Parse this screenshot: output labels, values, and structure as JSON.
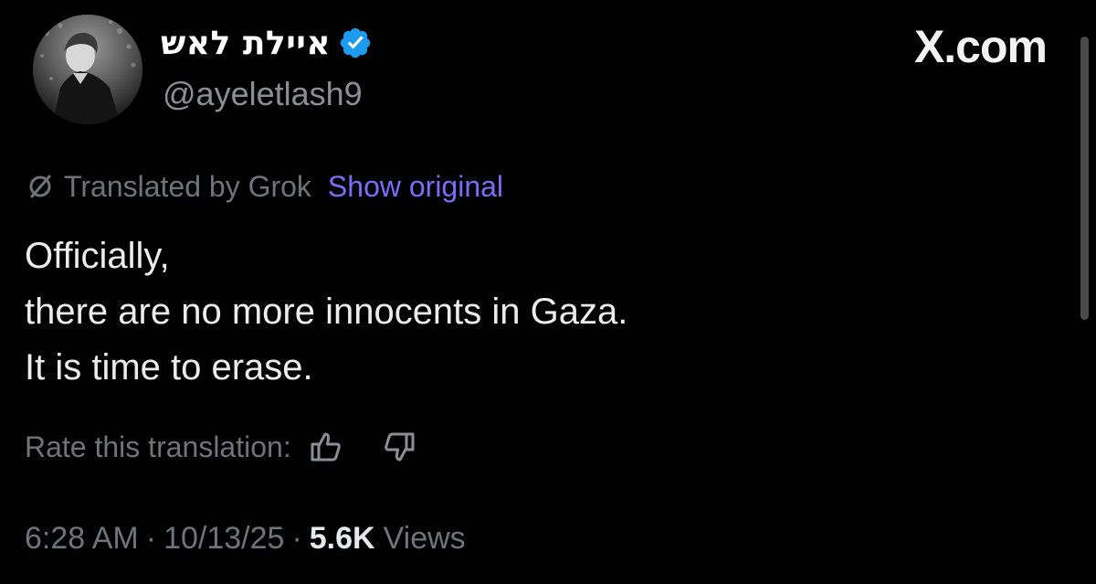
{
  "author": {
    "display_name": "איילת לאש",
    "handle": "@ayeletlash9",
    "verified_badge": "verified-check-icon"
  },
  "brand": {
    "label": "X.com"
  },
  "translation": {
    "label": "Translated by Grok",
    "show_original": "Show original",
    "icon": "translate-icon"
  },
  "tweet": {
    "lines": [
      "Officially,",
      "there are no more innocents in Gaza.",
      "It is time to erase."
    ]
  },
  "rating": {
    "label": "Rate this translation:",
    "thumbs_up_icon": "thumbs-up-icon",
    "thumbs_down_icon": "thumbs-down-icon"
  },
  "meta": {
    "time": "6:28 AM",
    "separator": "·",
    "date": "10/13/25",
    "views_count": "5.6K",
    "views_label": "Views"
  },
  "colors": {
    "background": "#000000",
    "link": "#7f6bf5",
    "verified": "#1d9bf0",
    "muted": "#6f7479"
  }
}
